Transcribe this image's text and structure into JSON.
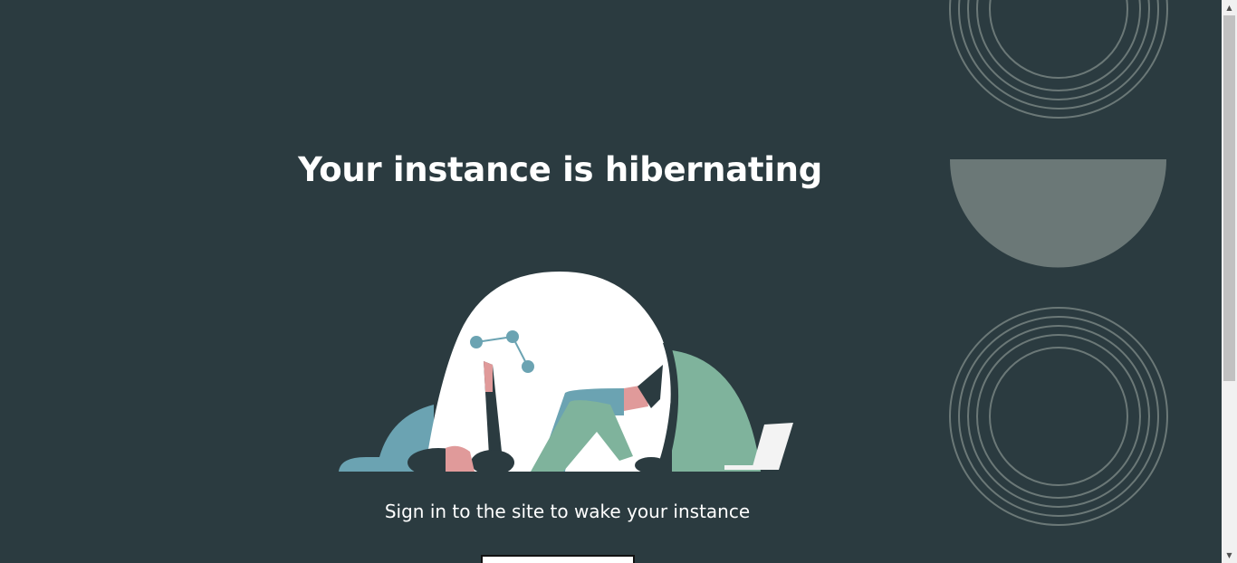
{
  "page": {
    "title": "Your instance is hibernating",
    "subtitle": "Sign in to the site to wake your instance",
    "button_label": "",
    "colors": {
      "background": "#2b3b40",
      "dome": "#ffffff",
      "teal": "#6ba3b2",
      "green": "#7fb39c",
      "pink": "#e09a9a",
      "decor_gray": "#6b7877"
    }
  },
  "decorations": {
    "top": "concentric-rings-icon",
    "middle": "half-circle-icon",
    "bottom": "concentric-rings-icon"
  },
  "scrollbar": {
    "up_arrow": "▲",
    "down_arrow": "▼"
  }
}
